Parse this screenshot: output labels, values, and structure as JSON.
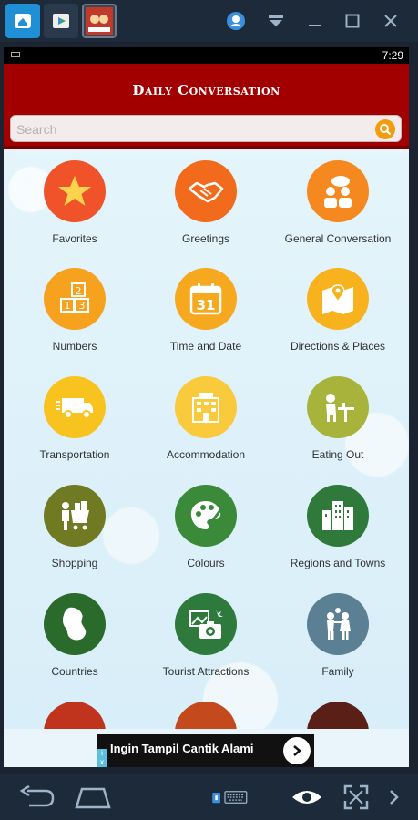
{
  "status": {
    "time": "7:29"
  },
  "header": {
    "title": "Daily Conversation"
  },
  "search": {
    "placeholder": "Search"
  },
  "categories": [
    {
      "label": "Favorites",
      "icon": "star-icon",
      "color": "#f0522a"
    },
    {
      "label": "Greetings",
      "icon": "handshake-icon",
      "color": "#f26a1b"
    },
    {
      "label": "General Conversation",
      "icon": "chat-people-icon",
      "color": "#f5891f"
    },
    {
      "label": "Numbers",
      "icon": "number-blocks-icon",
      "color": "#f6a21e"
    },
    {
      "label": "Time and Date",
      "icon": "calendar-icon",
      "color": "#f6a81e"
    },
    {
      "label": "Directions & Places",
      "icon": "map-pin-icon",
      "color": "#f7b21d"
    },
    {
      "label": "Transportation",
      "icon": "truck-icon",
      "color": "#f9c31f"
    },
    {
      "label": "Accommodation",
      "icon": "hotel-icon",
      "color": "#f9ca3c"
    },
    {
      "label": "Eating Out",
      "icon": "dining-icon",
      "color": "#a7b33a"
    },
    {
      "label": "Shopping",
      "icon": "shopping-cart-icon",
      "color": "#6f7a22"
    },
    {
      "label": "Colours",
      "icon": "palette-icon",
      "color": "#3b8a3a"
    },
    {
      "label": "Regions and Towns",
      "icon": "buildings-icon",
      "color": "#2f7a3a"
    },
    {
      "label": "Countries",
      "icon": "country-map-icon",
      "color": "#2a6a2a"
    },
    {
      "label": "Tourist Attractions",
      "icon": "camera-icon",
      "color": "#2e7a3c"
    },
    {
      "label": "Family",
      "icon": "family-icon",
      "color": "#5b7f93"
    }
  ],
  "ad": {
    "text": "Ingin Tampil Cantik Alami",
    "info": "i",
    "close": "x"
  }
}
